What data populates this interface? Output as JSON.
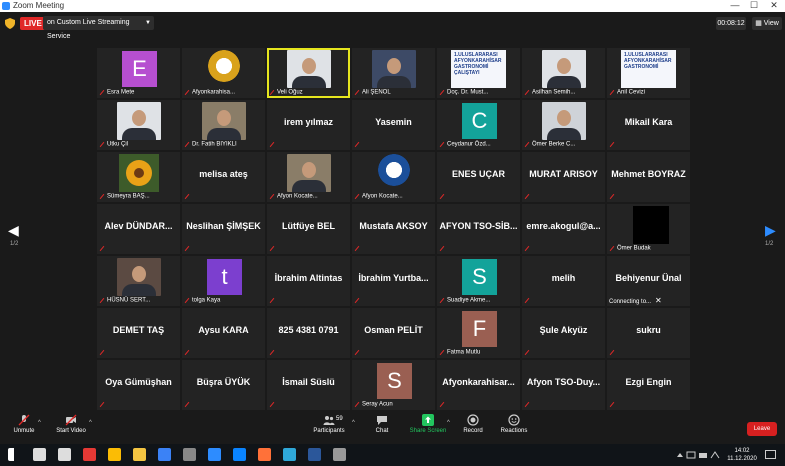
{
  "window": {
    "title": "Zoom Meeting",
    "minimize": "—",
    "maximize": "☐",
    "close": "✕"
  },
  "topbar": {
    "live_badge": "LIVE",
    "live_menu": "on Custom Live Streaming Service",
    "timer": "00:08:12",
    "view_button": "View"
  },
  "page_indicator": {
    "left": "1/2",
    "right": "1/2"
  },
  "participants": [
    {
      "type": "letter",
      "letter": "E",
      "letter_color": "#b64fd0",
      "label": "Esra Mete"
    },
    {
      "type": "emblem",
      "emblem_color": "#d9a21c",
      "label": "Afyonkarahisa..."
    },
    {
      "type": "photo",
      "photo_bg": "#dfe2e6",
      "label": "Veli Oğuz",
      "active": true
    },
    {
      "type": "photo",
      "photo_bg": "#3d4a66",
      "label": "Ali ŞENOL"
    },
    {
      "type": "poster",
      "poster_text": "1.ULUSLARARASI AFYONKARAHİSAR GASTRONOMİ ÇALIŞTAYI",
      "label": "Doç. Dr. Must..."
    },
    {
      "type": "photo",
      "photo_bg": "#dfe2e6",
      "label": "Asilhan Semih..."
    },
    {
      "type": "poster",
      "poster_text": "1.ULUSLARARASI AFYONKARAHİSAR GASTRONOMİ",
      "label": "Anil Cevizi"
    },
    {
      "type": "photo",
      "photo_bg": "#dfe2e6",
      "label": "Utku Çil"
    },
    {
      "type": "photo",
      "photo_bg": "#8a7d68",
      "label": "Dr. Fatih BIYIKLI"
    },
    {
      "type": "name",
      "name": "irem yılmaz",
      "label": ""
    },
    {
      "type": "name",
      "name": "Yasemin",
      "label": ""
    },
    {
      "type": "letter",
      "letter": "C",
      "letter_color": "#13a39a",
      "label": "Ceydanur Özd..."
    },
    {
      "type": "photo",
      "photo_bg": "#cfd3d8",
      "label": "Ömer Berke C..."
    },
    {
      "type": "name",
      "name": "Mikail Kara",
      "label": ""
    },
    {
      "type": "sunflower",
      "label": "Sümeyra BAŞ..."
    },
    {
      "type": "name",
      "name": "melisa ateş",
      "label": ""
    },
    {
      "type": "photo",
      "photo_bg": "#8a7d68",
      "label": "Afyon Kocate..."
    },
    {
      "type": "emblem",
      "emblem_color": "#1b4f9a",
      "label": "Afyon Kocate..."
    },
    {
      "type": "name",
      "name": "ENES UÇAR",
      "label": ""
    },
    {
      "type": "name",
      "name": "MURAT ARISOY",
      "label": ""
    },
    {
      "type": "name",
      "name": "Mehmet BOYRAZ",
      "label": ""
    },
    {
      "type": "name",
      "name": "Alev  DÜNDAR...",
      "label": ""
    },
    {
      "type": "name",
      "name": "Neslihan ŞİMŞEK",
      "label": ""
    },
    {
      "type": "name",
      "name": "Lütfüye BEL",
      "label": ""
    },
    {
      "type": "name",
      "name": "Mustafa AKSOY",
      "label": ""
    },
    {
      "type": "name",
      "name": "AFYON  TSO-SİB...",
      "label": ""
    },
    {
      "type": "name",
      "name": "emre.akogul@a...",
      "label": ""
    },
    {
      "type": "black",
      "label": "Ömer Budak"
    },
    {
      "type": "photo",
      "photo_bg": "#5b4a42",
      "label": "HÜSNÜ SERT..."
    },
    {
      "type": "letter",
      "letter": "t",
      "letter_color": "#7c3fcf",
      "label": "tolga Kaya"
    },
    {
      "type": "name",
      "name": "İbrahim Altintas",
      "label": ""
    },
    {
      "type": "name",
      "name": "İbrahim  Yurtba...",
      "label": ""
    },
    {
      "type": "letter",
      "letter": "S",
      "letter_color": "#13a39a",
      "label": "Suadiye Akme..."
    },
    {
      "type": "name",
      "name": "melih",
      "label": ""
    },
    {
      "type": "name",
      "name": "Behiyenur Ünal",
      "label": "Connecting to...",
      "connecting": true
    },
    {
      "type": "name",
      "name": "DEMET TAŞ",
      "label": ""
    },
    {
      "type": "name",
      "name": "Aysu KARA",
      "label": ""
    },
    {
      "type": "name",
      "name": "825 4381 0791",
      "label": ""
    },
    {
      "type": "name",
      "name": "Osman PELİT",
      "label": ""
    },
    {
      "type": "letter",
      "letter": "F",
      "letter_color": "#9a5f52",
      "label": "Fatma Mutlu"
    },
    {
      "type": "name",
      "name": "Şule Akyüz",
      "label": ""
    },
    {
      "type": "name",
      "name": "sukru",
      "label": ""
    },
    {
      "type": "name",
      "name": "Oya Gümüşhan",
      "label": ""
    },
    {
      "type": "name",
      "name": "Büşra ÜYÜK",
      "label": ""
    },
    {
      "type": "name",
      "name": "İsmail Süslü",
      "label": ""
    },
    {
      "type": "letter",
      "letter": "S",
      "letter_color": "#9a5f52",
      "label": "Seray Acun"
    },
    {
      "type": "name",
      "name": "Afyonkarahisar...",
      "label": ""
    },
    {
      "type": "name",
      "name": "Afyon  TSO-Duy...",
      "label": ""
    },
    {
      "type": "name",
      "name": "Ezgi Engin",
      "label": ""
    }
  ],
  "toolbar": {
    "unmute": "Unmute",
    "start_video": "Start Video",
    "participants": "Participants",
    "participants_count": "59",
    "chat": "Chat",
    "share_screen": "Share Screen",
    "record": "Record",
    "reactions": "Reactions",
    "leave": "Leave"
  },
  "taskbar": {
    "time": "14:02",
    "date": "11.12.2020",
    "icons": [
      "windows-logo-icon",
      "search-icon",
      "task-view-icon",
      "yandex-icon",
      "chrome-icon",
      "file-explorer-icon",
      "store-icon",
      "camera-icon",
      "zoom-icon",
      "edge-icon",
      "firefox-icon",
      "edge-new-icon",
      "word-icon",
      "document-icon"
    ]
  },
  "colors": {
    "accent": "#2d8cff",
    "live": "#e02828",
    "share": "#22c55e",
    "leave": "#d72020",
    "active_border": "#e5e51e"
  }
}
